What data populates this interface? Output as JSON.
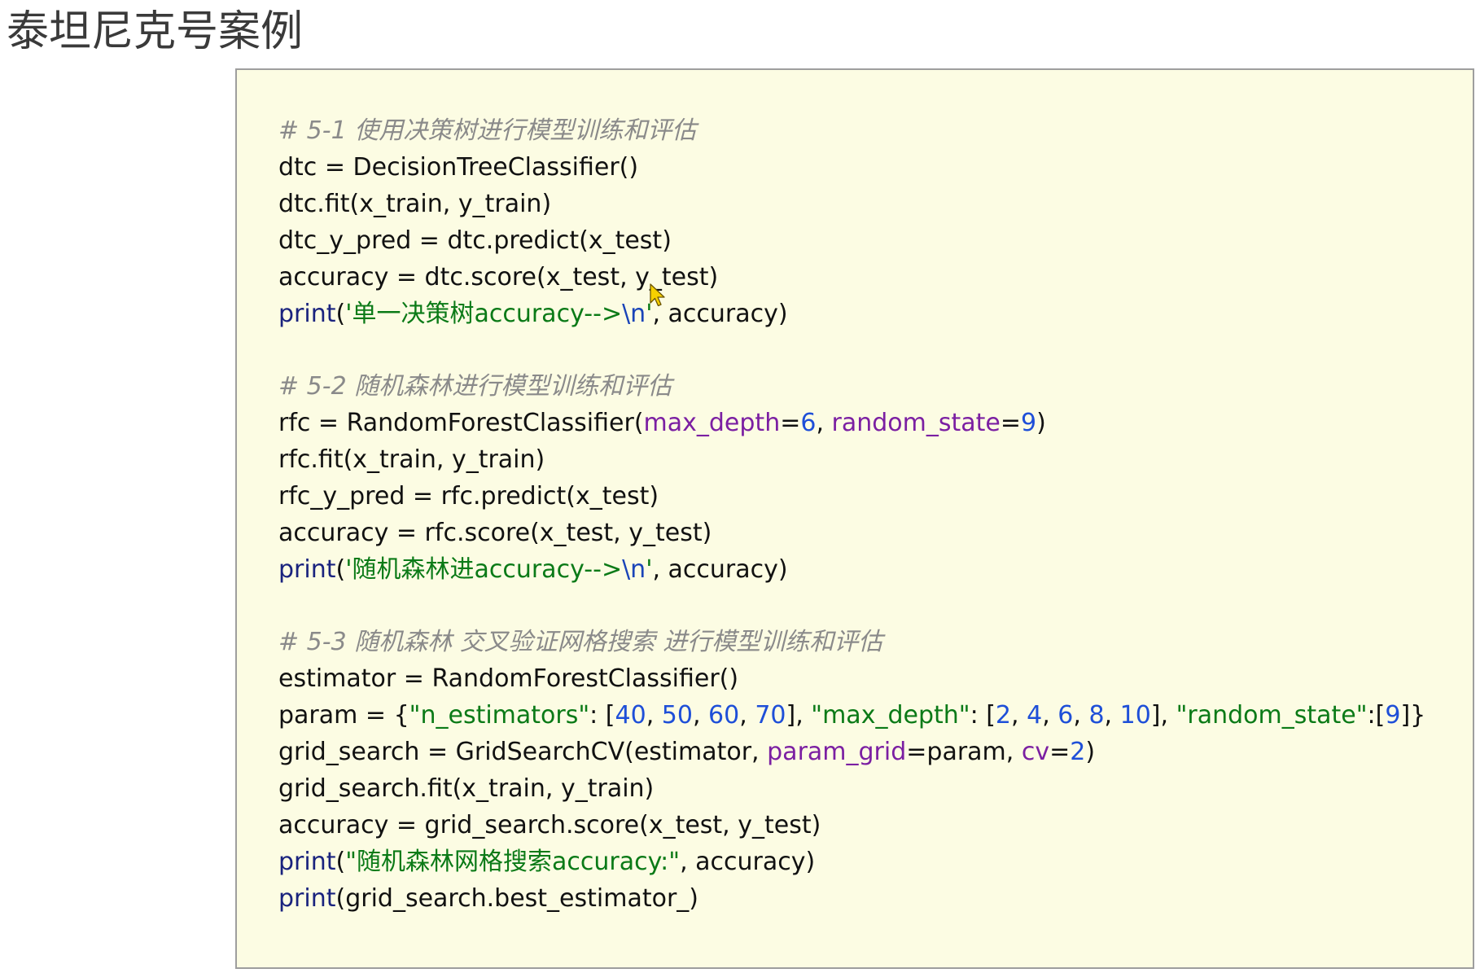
{
  "title": "泰坦尼克号案例",
  "code_blocks": [
    {
      "comment": "# 5-1 使用决策树进行模型训练和评估",
      "lines": [
        [
          {
            "t": "dtc = DecisionTreeClassifier()"
          }
        ],
        [
          {
            "t": "dtc.fit(x_train, y_train)"
          }
        ],
        [
          {
            "t": "dtc_y_pred = dtc.predict(x_test)"
          }
        ],
        [
          {
            "t": "accuracy = dtc.score(x_test, y_test)"
          }
        ],
        [
          {
            "t": "print",
            "c": "kw"
          },
          {
            "t": "("
          },
          {
            "t": "'单一决策树accuracy-->",
            "c": "str"
          },
          {
            "t": "\\n",
            "c": "esc"
          },
          {
            "t": "'",
            "c": "str"
          },
          {
            "t": ", accuracy)"
          }
        ]
      ]
    },
    {
      "comment": "# 5-2 随机森林进行模型训练和评估",
      "lines": [
        [
          {
            "t": "rfc = RandomForestClassifier("
          },
          {
            "t": "max_depth",
            "c": "param"
          },
          {
            "t": "="
          },
          {
            "t": "6",
            "c": "num"
          },
          {
            "t": ", "
          },
          {
            "t": "random_state",
            "c": "param"
          },
          {
            "t": "="
          },
          {
            "t": "9",
            "c": "num"
          },
          {
            "t": ")"
          }
        ],
        [
          {
            "t": "rfc.fit(x_train, y_train)"
          }
        ],
        [
          {
            "t": "rfc_y_pred = rfc.predict(x_test)"
          }
        ],
        [
          {
            "t": "accuracy = rfc.score(x_test, y_test)"
          }
        ],
        [
          {
            "t": "print",
            "c": "kw"
          },
          {
            "t": "("
          },
          {
            "t": "'随机森林进accuracy-->",
            "c": "str"
          },
          {
            "t": "\\n",
            "c": "esc"
          },
          {
            "t": "'",
            "c": "str"
          },
          {
            "t": ", accuracy)"
          }
        ]
      ]
    },
    {
      "comment": "# 5-3 随机森林 交叉验证网格搜索 进行模型训练和评估",
      "lines": [
        [
          {
            "t": "estimator = RandomForestClassifier()"
          }
        ],
        [
          {
            "t": "param = {"
          },
          {
            "t": "\"n_estimators\"",
            "c": "str"
          },
          {
            "t": ": ["
          },
          {
            "t": "40",
            "c": "num"
          },
          {
            "t": ", "
          },
          {
            "t": "50",
            "c": "num"
          },
          {
            "t": ", "
          },
          {
            "t": "60",
            "c": "num"
          },
          {
            "t": ", "
          },
          {
            "t": "70",
            "c": "num"
          },
          {
            "t": "], "
          },
          {
            "t": "\"max_depth\"",
            "c": "str"
          },
          {
            "t": ": ["
          },
          {
            "t": "2",
            "c": "num"
          },
          {
            "t": ", "
          },
          {
            "t": "4",
            "c": "num"
          },
          {
            "t": ", "
          },
          {
            "t": "6",
            "c": "num"
          },
          {
            "t": ", "
          },
          {
            "t": "8",
            "c": "num"
          },
          {
            "t": ", "
          },
          {
            "t": "10",
            "c": "num"
          },
          {
            "t": "], "
          },
          {
            "t": "\"random_state\"",
            "c": "str"
          },
          {
            "t": ":["
          },
          {
            "t": "9",
            "c": "num"
          },
          {
            "t": "]}"
          }
        ],
        [
          {
            "t": "grid_search = GridSearchCV(estimator, "
          },
          {
            "t": "param_grid",
            "c": "param"
          },
          {
            "t": "=param, "
          },
          {
            "t": "cv",
            "c": "param"
          },
          {
            "t": "="
          },
          {
            "t": "2",
            "c": "num"
          },
          {
            "t": ")"
          }
        ],
        [
          {
            "t": "grid_search.fit(x_train, y_train)"
          }
        ],
        [
          {
            "t": "accuracy = grid_search.score(x_test, y_test)"
          }
        ],
        [
          {
            "t": "print",
            "c": "kw"
          },
          {
            "t": "("
          },
          {
            "t": "\"随机森林网格搜索accuracy:\"",
            "c": "str"
          },
          {
            "t": ", accuracy)"
          }
        ],
        [
          {
            "t": "print",
            "c": "kw"
          },
          {
            "t": "(grid_search.best_estimator_)"
          }
        ]
      ]
    }
  ],
  "colors": {
    "background": "#ffffff",
    "code_box": "#fcfce3",
    "comment": "#8a8a8a",
    "keyword": "#1a237e",
    "string": "#0b7a17",
    "number": "#1e4fd8",
    "param_name": "#7b1fa2"
  },
  "icons": {
    "cursor": "mouse-pointer-icon"
  }
}
